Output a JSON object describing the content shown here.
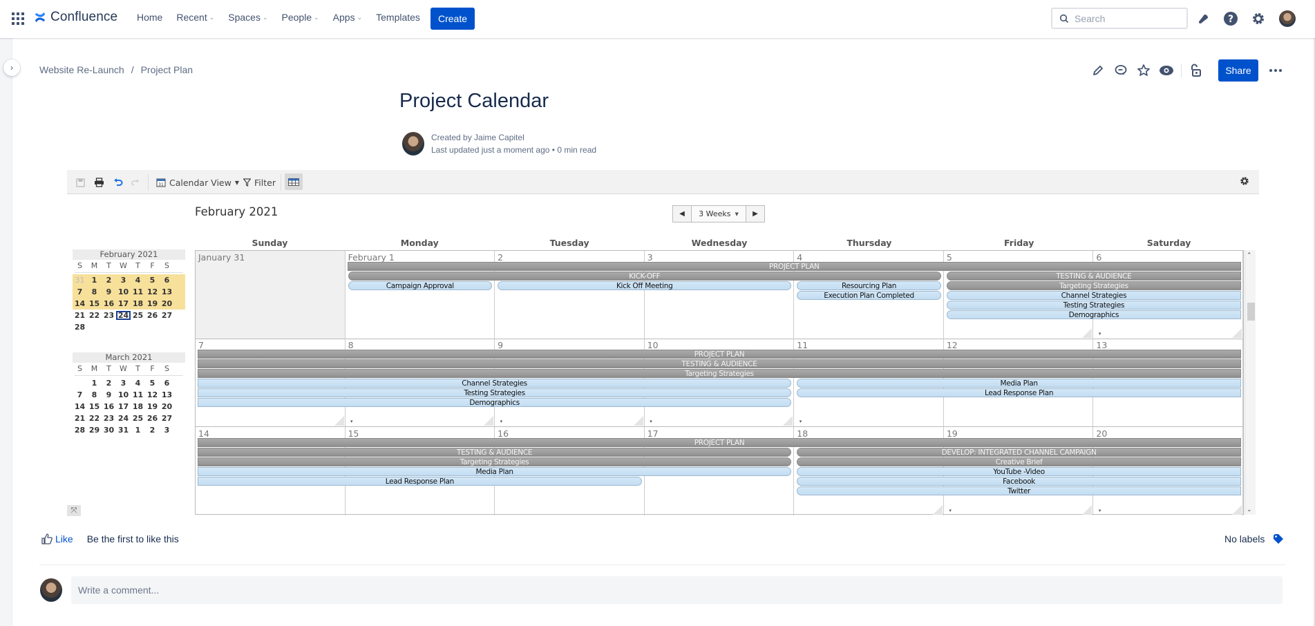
{
  "topnav": {
    "product": "Confluence",
    "items": [
      {
        "label": "Home",
        "dropdown": false
      },
      {
        "label": "Recent",
        "dropdown": true
      },
      {
        "label": "Spaces",
        "dropdown": true
      },
      {
        "label": "People",
        "dropdown": true
      },
      {
        "label": "Apps",
        "dropdown": true
      },
      {
        "label": "Templates",
        "dropdown": false
      }
    ],
    "create_label": "Create",
    "search_placeholder": "Search",
    "icons": [
      "notifications-icon",
      "help-icon",
      "settings-icon",
      "profile-avatar"
    ],
    "brand_color": "#0052cc"
  },
  "breadcrumb": [
    "Website Re-Launch",
    "Project Plan"
  ],
  "page_actions": {
    "icons": [
      "edit-icon",
      "comment-icon",
      "star-icon",
      "watch-icon",
      "restrictions-icon"
    ],
    "share_label": "Share",
    "more_label": "•••"
  },
  "page": {
    "title": "Project Calendar",
    "created_by": "Created by Jaime Capitel",
    "last_updated": "Last updated just a moment ago",
    "read_time": "0 min read"
  },
  "calendar": {
    "toolbar": {
      "view_label": "Calendar View",
      "filter_label": "Filter"
    },
    "month_title": "February 2021",
    "range_label": "3 Weeks",
    "days_of_week": [
      "Sunday",
      "Monday",
      "Tuesday",
      "Wednesday",
      "Thursday",
      "Friday",
      "Saturday"
    ],
    "weeks": [
      {
        "days": [
          "January 31",
          "February 1",
          "2",
          "3",
          "4",
          "5",
          "6"
        ],
        "other_month": [
          true,
          false,
          false,
          false,
          false,
          false,
          false
        ],
        "more_indicators": [
          false,
          false,
          false,
          false,
          false,
          true,
          true
        ],
        "events": [
          {
            "title": "PROJECT PLAN",
            "type": "gray",
            "start": 1,
            "span": 6,
            "row": 0,
            "round_left": false,
            "round_right": false
          },
          {
            "title": "KICK-OFF",
            "type": "gray",
            "start": 1,
            "span": 4,
            "row": 1,
            "round_left": true,
            "round_right": true
          },
          {
            "title": "TESTING & AUDIENCE",
            "type": "gray",
            "start": 5,
            "span": 2,
            "row": 1,
            "round_left": true,
            "round_right": false
          },
          {
            "title": "Campaign Approval",
            "type": "blue",
            "start": 1,
            "span": 1,
            "row": 2,
            "round_left": true,
            "round_right": true
          },
          {
            "title": "Kick Off Meeting",
            "type": "blue",
            "start": 2,
            "span": 2,
            "row": 2,
            "round_left": true,
            "round_right": true
          },
          {
            "title": "Resourcing Plan",
            "type": "blue",
            "start": 4,
            "span": 1,
            "row": 2,
            "round_left": true,
            "round_right": true
          },
          {
            "title": "Targeting Strategies",
            "type": "gray",
            "start": 5,
            "span": 2,
            "row": 2,
            "round_left": true,
            "round_right": false
          },
          {
            "title": "Execution Plan Completed",
            "type": "blue",
            "start": 4,
            "span": 1,
            "row": 3,
            "round_left": true,
            "round_right": true
          },
          {
            "title": "Channel Strategies",
            "type": "blue",
            "start": 5,
            "span": 2,
            "row": 3,
            "round_left": true,
            "round_right": false
          },
          {
            "title": "Testing Strategies",
            "type": "blue",
            "start": 5,
            "span": 2,
            "row": 4,
            "round_left": true,
            "round_right": false
          },
          {
            "title": "Demographics",
            "type": "blue",
            "start": 5,
            "span": 2,
            "row": 5,
            "round_left": true,
            "round_right": false
          }
        ]
      },
      {
        "days": [
          "7",
          "8",
          "9",
          "10",
          "11",
          "12",
          "13"
        ],
        "other_month": [
          false,
          false,
          false,
          false,
          false,
          false,
          false
        ],
        "more_indicators": [
          true,
          true,
          true,
          true,
          false,
          false,
          false
        ],
        "events": [
          {
            "title": "PROJECT PLAN",
            "type": "gray",
            "start": 0,
            "span": 7,
            "row": 0,
            "round_left": false,
            "round_right": false
          },
          {
            "title": "TESTING & AUDIENCE",
            "type": "gray",
            "start": 0,
            "span": 7,
            "row": 1,
            "round_left": false,
            "round_right": false
          },
          {
            "title": "Targeting Strategies",
            "type": "gray",
            "start": 0,
            "span": 7,
            "row": 2,
            "round_left": false,
            "round_right": false
          },
          {
            "title": "Channel Strategies",
            "type": "blue",
            "start": 0,
            "span": 4,
            "row": 3,
            "round_left": false,
            "round_right": true
          },
          {
            "title": "Media Plan",
            "type": "blue",
            "start": 4,
            "span": 3,
            "row": 3,
            "round_left": true,
            "round_right": false
          },
          {
            "title": "Testing Strategies",
            "type": "blue",
            "start": 0,
            "span": 4,
            "row": 4,
            "round_left": false,
            "round_right": true
          },
          {
            "title": "Lead Response Plan",
            "type": "blue",
            "start": 4,
            "span": 3,
            "row": 4,
            "round_left": true,
            "round_right": false
          },
          {
            "title": "Demographics",
            "type": "blue",
            "start": 0,
            "span": 4,
            "row": 5,
            "round_left": false,
            "round_right": true
          }
        ]
      },
      {
        "days": [
          "14",
          "15",
          "16",
          "17",
          "18",
          "19",
          "20"
        ],
        "other_month": [
          false,
          false,
          false,
          false,
          false,
          false,
          false
        ],
        "more_indicators": [
          false,
          false,
          false,
          false,
          true,
          true,
          true
        ],
        "events": [
          {
            "title": "PROJECT PLAN",
            "type": "gray",
            "start": 0,
            "span": 7,
            "row": 0,
            "round_left": false,
            "round_right": false
          },
          {
            "title": "TESTING & AUDIENCE",
            "type": "gray",
            "start": 0,
            "span": 4,
            "row": 1,
            "round_left": false,
            "round_right": true
          },
          {
            "title": "DEVELOP: INTEGRATED CHANNEL CAMPAIGN",
            "type": "gray",
            "start": 4,
            "span": 3,
            "row": 1,
            "round_left": true,
            "round_right": false
          },
          {
            "title": "Targeting Strategies",
            "type": "gray",
            "start": 0,
            "span": 4,
            "row": 2,
            "round_left": false,
            "round_right": true
          },
          {
            "title": "Creative Brief",
            "type": "gray",
            "start": 4,
            "span": 3,
            "row": 2,
            "round_left": true,
            "round_right": false
          },
          {
            "title": "Media Plan",
            "type": "blue",
            "start": 0,
            "span": 4,
            "row": 3,
            "round_left": false,
            "round_right": true
          },
          {
            "title": "YouTube -Video",
            "type": "blue",
            "start": 4,
            "span": 3,
            "row": 3,
            "round_left": true,
            "round_right": false
          },
          {
            "title": "Lead Response Plan",
            "type": "blue",
            "start": 0,
            "span": 3,
            "row": 4,
            "round_left": false,
            "round_right": true
          },
          {
            "title": "Facebook",
            "type": "blue",
            "start": 4,
            "span": 3,
            "row": 4,
            "round_left": true,
            "round_right": false
          },
          {
            "title": "Twitter",
            "type": "blue",
            "start": 4,
            "span": 3,
            "row": 5,
            "round_left": true,
            "round_right": false
          }
        ]
      }
    ],
    "mini_calendars": [
      {
        "title": "February 2021",
        "dow": [
          "S",
          "M",
          "T",
          "W",
          "T",
          "F",
          "S"
        ],
        "rows": [
          [
            "31",
            "1",
            "2",
            "3",
            "4",
            "5",
            "6"
          ],
          [
            "7",
            "8",
            "9",
            "10",
            "11",
            "12",
            "13"
          ],
          [
            "14",
            "15",
            "16",
            "17",
            "18",
            "19",
            "20"
          ],
          [
            "21",
            "22",
            "23",
            "24",
            "25",
            "26",
            "27"
          ],
          [
            "28",
            "",
            "",
            "",
            "",
            "",
            ""
          ]
        ],
        "highlighted_rows": [
          0,
          1,
          2
        ],
        "dim_cells": [
          "0-0"
        ],
        "today": "3-3"
      },
      {
        "title": "March 2021",
        "dow": [
          "S",
          "M",
          "T",
          "W",
          "T",
          "F",
          "S"
        ],
        "rows": [
          [
            "",
            "1",
            "2",
            "3",
            "4",
            "5",
            "6"
          ],
          [
            "7",
            "8",
            "9",
            "10",
            "11",
            "12",
            "13"
          ],
          [
            "14",
            "15",
            "16",
            "17",
            "18",
            "19",
            "20"
          ],
          [
            "21",
            "22",
            "23",
            "24",
            "25",
            "26",
            "27"
          ],
          [
            "28",
            "29",
            "30",
            "31",
            "1",
            "2",
            "3"
          ]
        ],
        "highlighted_rows": [],
        "dim_cells": [],
        "today": null
      }
    ],
    "colors": {
      "gray_event": "#9e9e9e",
      "blue_event": "#c8e1f5",
      "highlight_week": "#f7e09a",
      "today_outline": "#1a3f8f"
    }
  },
  "footer": {
    "like_label": "Like",
    "like_text": "Be the first to like this",
    "labels_text": "No labels",
    "comment_placeholder": "Write a comment..."
  }
}
